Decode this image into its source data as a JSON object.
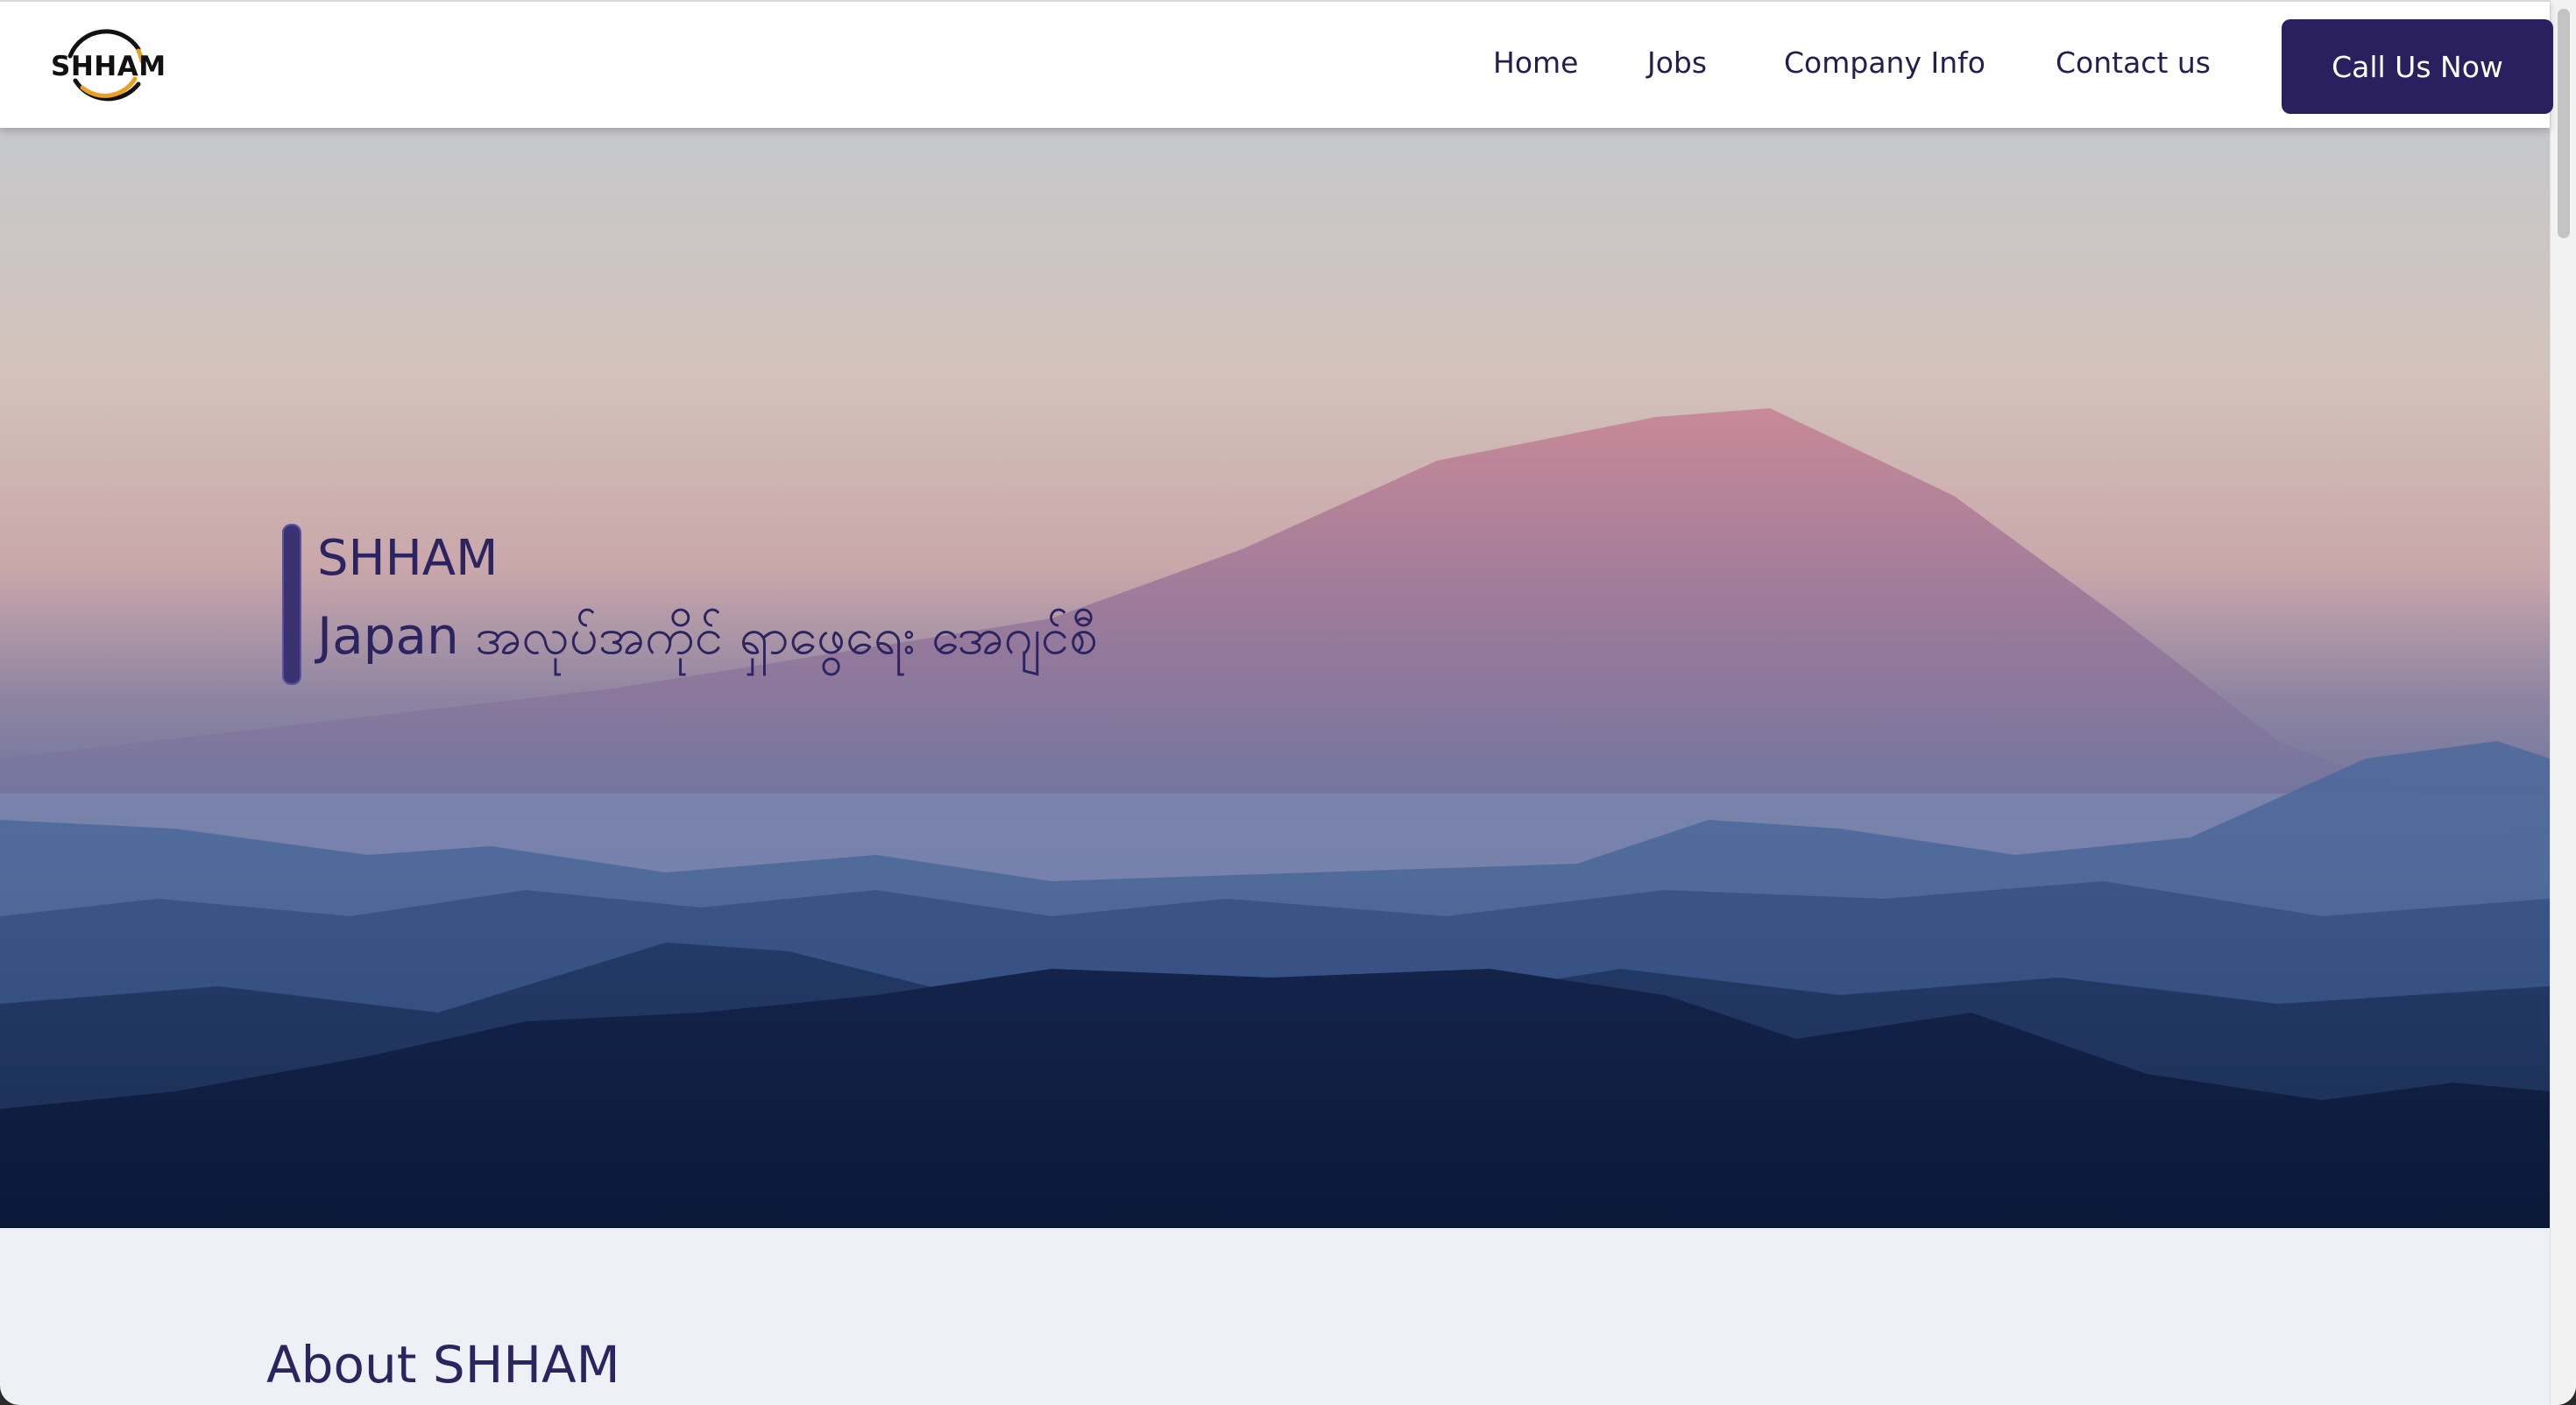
{
  "header": {
    "logo_text": "SHHAM",
    "nav": {
      "home": "Home",
      "jobs": "Jobs",
      "company_info": "Company Info",
      "contact_us": "Contact us"
    },
    "call_button": "Call Us Now"
  },
  "hero": {
    "title": "SHHAM",
    "subtitle": "Japan အလုပ်အကိုင် ရှာဖွေရေး အေဂျင်စီ"
  },
  "about": {
    "heading": "About SHHAM"
  },
  "colors": {
    "brand": "#2a2060",
    "text": "#241d4f",
    "section_bg": "#edf0f4",
    "logo_accent": "#e8a020"
  }
}
